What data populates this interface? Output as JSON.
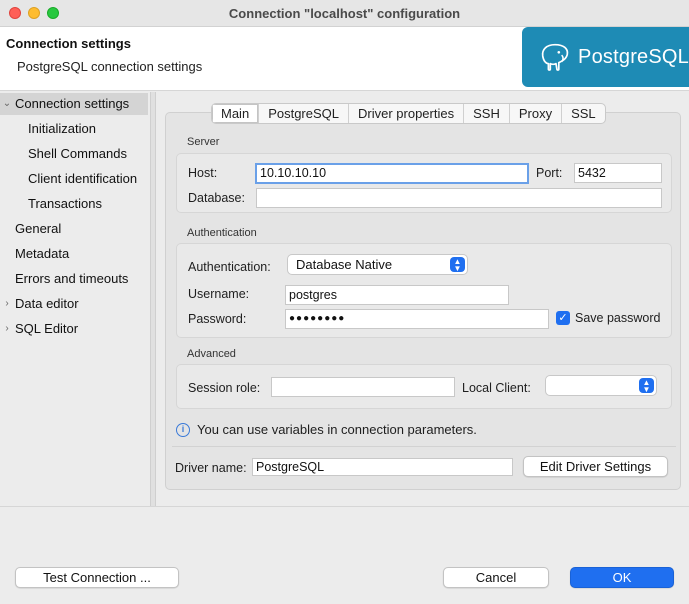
{
  "window": {
    "title": "Connection \"localhost\" configuration"
  },
  "header": {
    "title": "Connection settings",
    "subtitle": "PostgreSQL connection settings",
    "logo_text": "PostgreSQL",
    "logo_color": "#1e8bb5"
  },
  "sidebar": {
    "items": [
      {
        "label": "Connection settings",
        "expanded": true,
        "selected": true
      },
      {
        "label": "Initialization"
      },
      {
        "label": "Shell Commands"
      },
      {
        "label": "Client identification"
      },
      {
        "label": "Transactions"
      },
      {
        "label": "General"
      },
      {
        "label": "Metadata"
      },
      {
        "label": "Errors and timeouts"
      },
      {
        "label": "Data editor",
        "expandable": true
      },
      {
        "label": "SQL Editor",
        "expandable": true
      }
    ]
  },
  "tabs": [
    "Main",
    "PostgreSQL",
    "Driver properties",
    "SSH",
    "Proxy",
    "SSL"
  ],
  "active_tab": "Main",
  "server": {
    "section": "Server",
    "host_label": "Host:",
    "host_value": "10.10.10.10",
    "port_label": "Port:",
    "port_value": "5432",
    "database_label": "Database:",
    "database_value": ""
  },
  "auth": {
    "section": "Authentication",
    "auth_label": "Authentication:",
    "auth_value": "Database Native",
    "username_label": "Username:",
    "username_value": "postgres",
    "password_label": "Password:",
    "password_value": "●●●●●●●●",
    "save_password_label": "Save password",
    "save_password_checked": true
  },
  "advanced": {
    "section": "Advanced",
    "session_role_label": "Session role:",
    "session_role_value": "",
    "local_client_label": "Local Client:",
    "local_client_value": ""
  },
  "info": {
    "text": "You can use variables in connection parameters."
  },
  "driver": {
    "label": "Driver name:",
    "value": "PostgreSQL",
    "edit_button": "Edit Driver Settings"
  },
  "buttons": {
    "test": "Test Connection ...",
    "cancel": "Cancel",
    "ok": "OK"
  },
  "colors": {
    "accent": "#1f6ff0"
  }
}
